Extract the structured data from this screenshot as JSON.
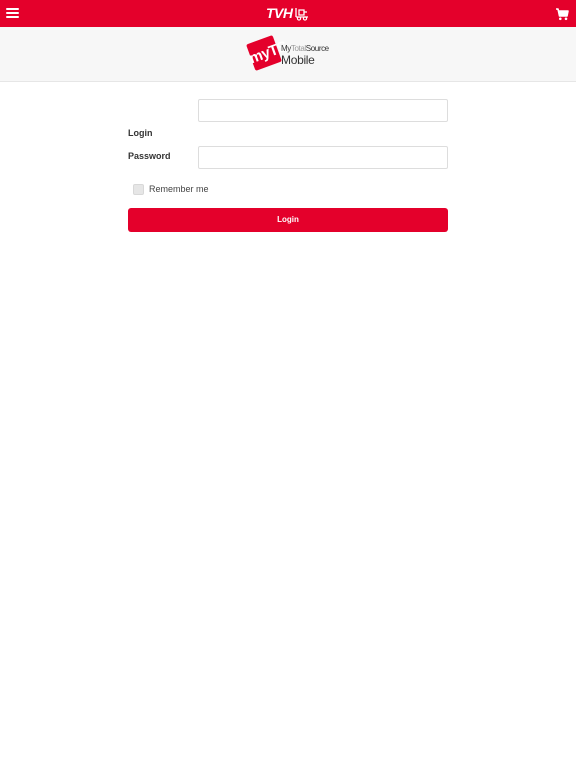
{
  "header": {
    "brand": "TVH",
    "menu_icon": "hamburger-menu-icon",
    "cart_icon": "shopping-cart-icon",
    "brand_color": "#e4002b"
  },
  "logo": {
    "mark": "myTS",
    "line1_a": "My",
    "line1_b": "Total",
    "line1_c": "Source",
    "line2": "Mobile"
  },
  "form": {
    "login_label": "Login",
    "login_value": "",
    "password_label": "Password",
    "password_value": "",
    "remember_label": "Remember me",
    "remember_checked": false,
    "submit_label": "Login"
  }
}
